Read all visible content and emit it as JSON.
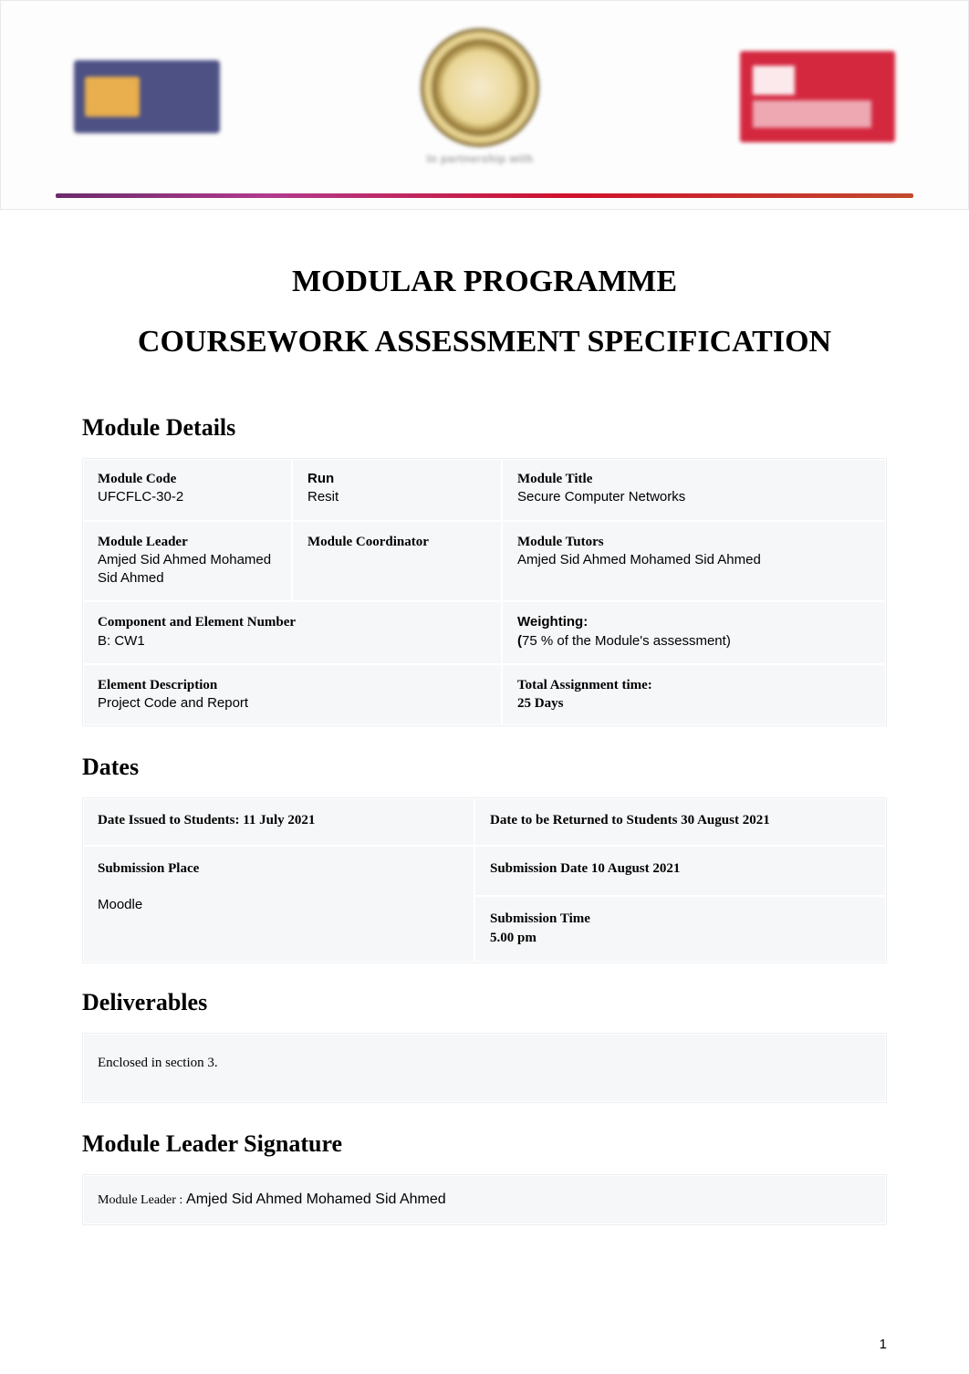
{
  "banner": {
    "logo_left_name": "gcet-logo",
    "logo_center_name": "college-seal-logo",
    "logo_center_sub": "In partnership with",
    "logo_right_name": "uwe-bristol-logo"
  },
  "titles": {
    "line1": "MODULAR PROGRAMME",
    "line2": "COURSEWORK ASSESSMENT SPECIFICATION"
  },
  "module_details": {
    "heading": "Module Details",
    "module_code": {
      "label": "Module Code",
      "value": "UFCFLC-30-2"
    },
    "run": {
      "label": "Run",
      "value": "Resit"
    },
    "module_title": {
      "label": "Module Title",
      "value": "Secure Computer Networks"
    },
    "module_leader": {
      "label": "Module Leader",
      "value": "Amjed Sid Ahmed Mohamed Sid Ahmed"
    },
    "module_coordinator": {
      "label": "Module Coordinator",
      "value": ""
    },
    "module_tutors": {
      "label": "Module Tutors",
      "value": "Amjed Sid Ahmed Mohamed Sid Ahmed"
    },
    "component": {
      "label": "Component and Element Number",
      "value": "B: CW1"
    },
    "weighting": {
      "label": "Weighting:",
      "value_prefix": "(",
      "value_body": "75 % of the Module's assessment)",
      "value": "(75 % of the Module's assessment)"
    },
    "element_desc": {
      "label": "Element Description",
      "value": "Project Code and Report"
    },
    "total_time": {
      "label": "Total Assignment time:",
      "value": "25 Days"
    }
  },
  "dates": {
    "heading": "Dates",
    "issued": {
      "label": "Date Issued to Students:",
      "value": "11 July 2021"
    },
    "returned": {
      "label": "Date to be Returned to Students",
      "value": "30 August 2021"
    },
    "place": {
      "label": "Submission Place",
      "value": "Moodle"
    },
    "sub_date": {
      "label": "Submission Date",
      "value": "10 August 2021"
    },
    "sub_time": {
      "label": "Submission Time",
      "value": "5.00 pm"
    }
  },
  "deliverables": {
    "heading": "Deliverables",
    "body": "Enclosed in section 3."
  },
  "signature": {
    "heading": "Module Leader Signature",
    "label": "Module Leader :",
    "value": "Amjed Sid Ahmed Mohamed Sid Ahmed"
  },
  "page_number": "1"
}
